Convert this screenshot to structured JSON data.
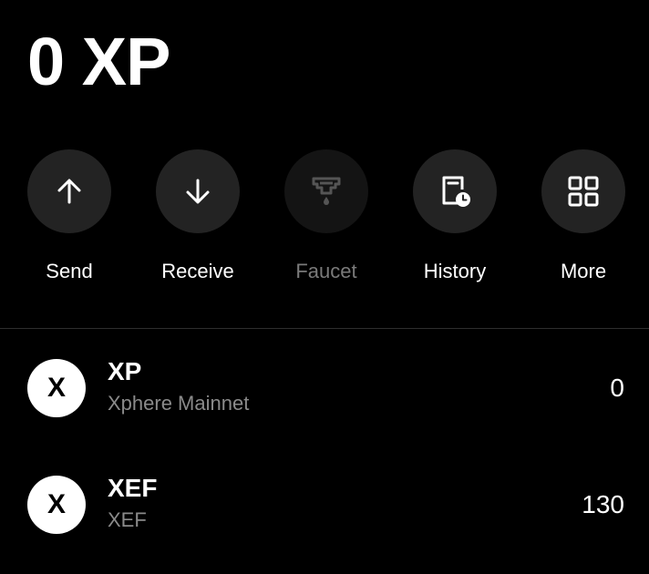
{
  "balance": {
    "text": "0 XP"
  },
  "actions": [
    {
      "label": "Send",
      "icon": "arrow-up-icon",
      "enabled": true
    },
    {
      "label": "Receive",
      "icon": "arrow-down-icon",
      "enabled": true
    },
    {
      "label": "Faucet",
      "icon": "faucet-icon",
      "enabled": false
    },
    {
      "label": "History",
      "icon": "history-icon",
      "enabled": true
    },
    {
      "label": "More",
      "icon": "grid-icon",
      "enabled": true
    }
  ],
  "tokens": [
    {
      "logo_letter": "X",
      "symbol": "XP",
      "network": "Xphere Mainnet",
      "amount": "0"
    },
    {
      "logo_letter": "X",
      "symbol": "XEF",
      "network": "XEF",
      "amount": "130"
    }
  ],
  "colors": {
    "background": "#000000",
    "button_bg": "#232323",
    "button_disabled_bg": "#141414",
    "text_primary": "#ffffff",
    "text_secondary": "#8a8a8a",
    "text_disabled": "#7a7a7a",
    "divider": "#2e2e2e"
  }
}
